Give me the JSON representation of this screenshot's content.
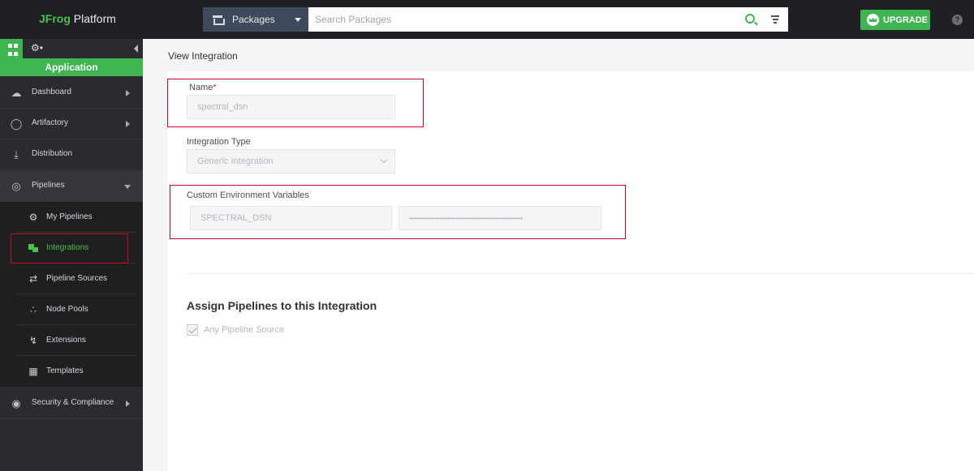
{
  "topbar": {
    "brand_jf": "JFrog",
    "brand_rest": " Platform",
    "package_select": "Packages",
    "search_placeholder": "Search Packages",
    "upgrade_label": "UPGRADE",
    "help": "?"
  },
  "sidebar": {
    "app_label": "Application",
    "items": [
      {
        "label": "Dashboard",
        "icon": "dashboard-icon"
      },
      {
        "label": "Artifactory",
        "icon": "artifactory-icon"
      },
      {
        "label": "Distribution",
        "icon": "distribution-icon"
      },
      {
        "label": "Pipelines",
        "icon": "pipelines-icon"
      },
      {
        "label": "Security & Compliance",
        "icon": "security-icon"
      }
    ],
    "sub_items": [
      {
        "label": "My Pipelines",
        "icon": "my-pipelines-icon"
      },
      {
        "label": "Integrations",
        "icon": "integrations-icon"
      },
      {
        "label": "Pipeline Sources",
        "icon": "pipeline-sources-icon"
      },
      {
        "label": "Node Pools",
        "icon": "node-pools-icon"
      },
      {
        "label": "Extensions",
        "icon": "extensions-icon"
      },
      {
        "label": "Templates",
        "icon": "templates-icon"
      }
    ]
  },
  "main": {
    "title": "View Integration",
    "name_label": "Name",
    "name_required": "*",
    "name_value": "spectral_dsn",
    "type_label": "Integration Type",
    "type_value": "Generic Integration",
    "env_label": "Custom Environment Variables",
    "env_key": "SPECTRAL_DSN",
    "env_value": "••••••••••••••••••••••••••••••••••••••••••••••••••••••••",
    "assign_title": "Assign Pipelines to this Integration",
    "any_source_label": "Any Pipeline Source",
    "any_source_checked": true
  },
  "colors": {
    "accent": "#3eb551",
    "topbar": "#1f2023",
    "sidebar": "#2a2b2e",
    "highlight_box": "#d0021b"
  }
}
